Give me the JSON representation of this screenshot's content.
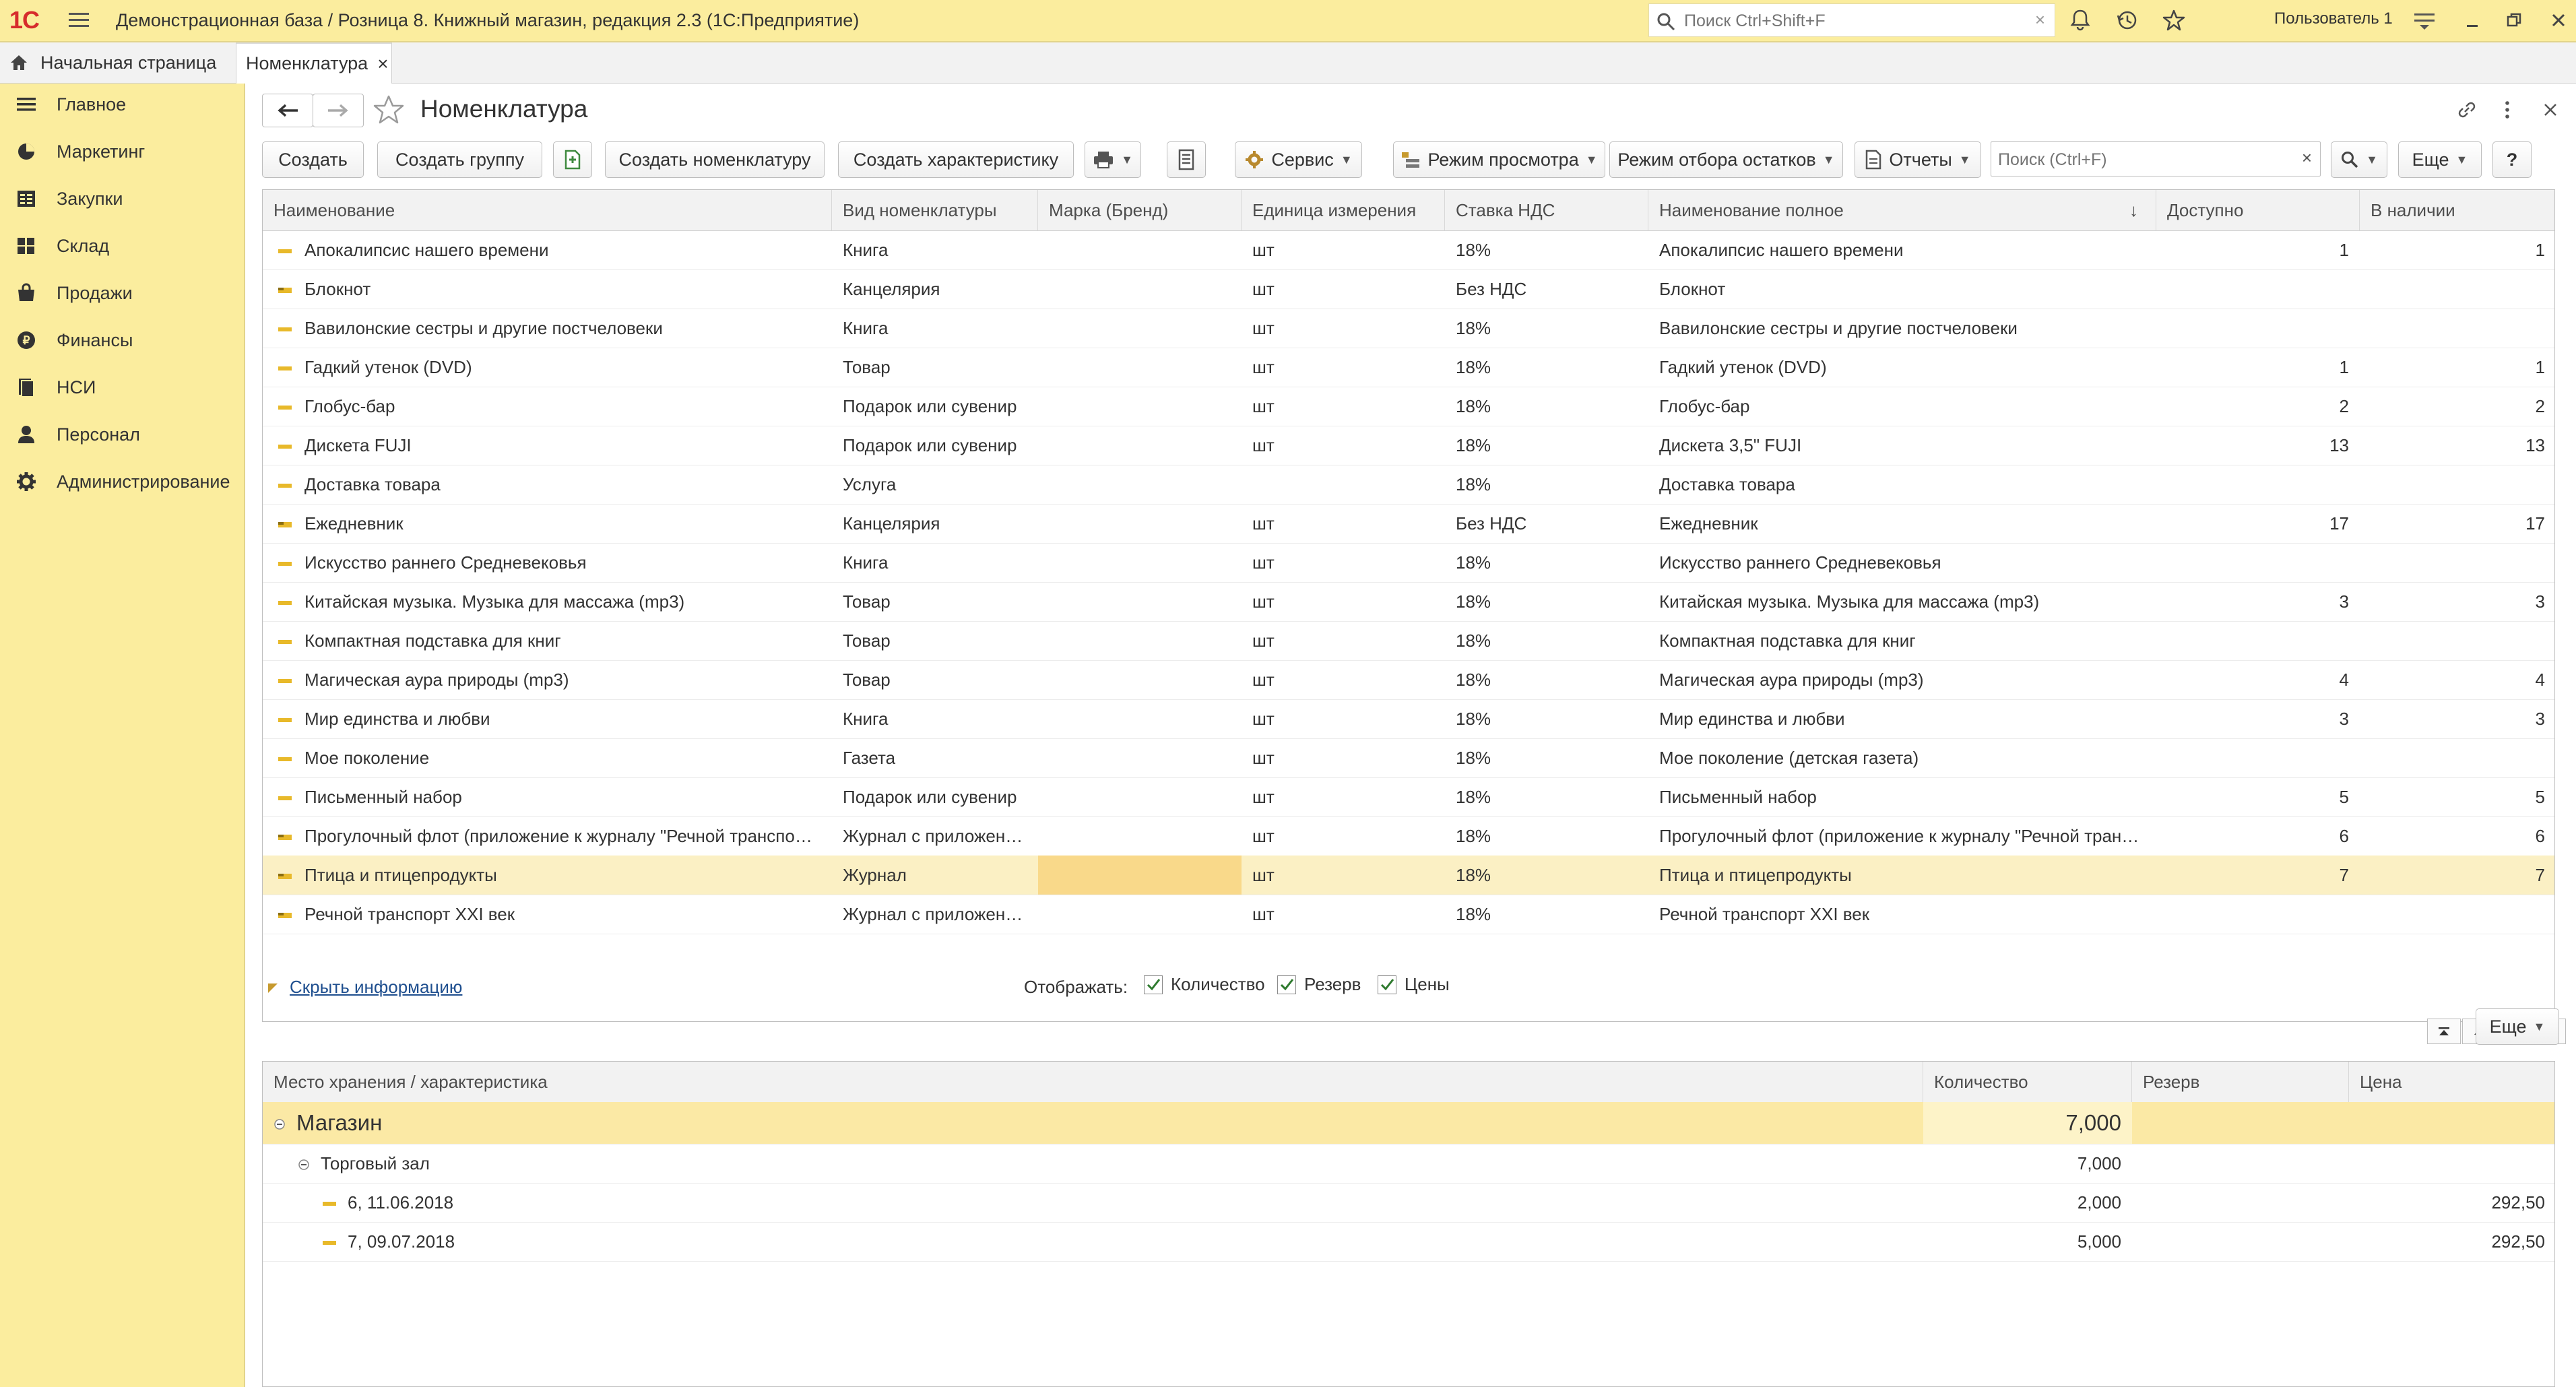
{
  "topbar": {
    "logo": "1С",
    "title": "Демонстрационная база / Розница 8. Книжный магазин, редакция 2.3  (1С:Предприятие)",
    "search_placeholder": "Поиск Ctrl+Shift+F",
    "search_clear": "×",
    "user": "Пользователь 1"
  },
  "tabs": {
    "home": "Начальная страница",
    "active": "Номенклатура",
    "close": "×"
  },
  "sidebar": {
    "items": [
      {
        "label": "Главное",
        "icon": "menu-icon"
      },
      {
        "label": "Маркетинг",
        "icon": "marketing-icon"
      },
      {
        "label": "Закупки",
        "icon": "purchases-icon"
      },
      {
        "label": "Склад",
        "icon": "warehouse-icon"
      },
      {
        "label": "Продажи",
        "icon": "sales-icon"
      },
      {
        "label": "Финансы",
        "icon": "finance-icon"
      },
      {
        "label": "НСИ",
        "icon": "reference-icon"
      },
      {
        "label": "Персонал",
        "icon": "person-icon"
      },
      {
        "label": "Администрирование",
        "icon": "gear-icon"
      }
    ]
  },
  "form": {
    "title": "Номенклатура"
  },
  "toolbar": {
    "create": "Создать",
    "create_group": "Создать группу",
    "create_item": "Создать номенклатуру",
    "create_characteristic": "Создать характеристику",
    "service": "Сервис",
    "view_mode": "Режим просмотра",
    "stock_filter_mode": "Режим отбора остатков",
    "reports": "Отчеты",
    "search_placeholder": "Поиск (Ctrl+F)",
    "search_clear": "×",
    "more": "Еще",
    "help": "?"
  },
  "table": {
    "columns": [
      "Наименование",
      "Вид номенклатуры",
      "Марка (Бренд)",
      "Единица измерения",
      "Ставка НДС",
      "Наименование полное",
      "Доступно",
      "В наличии"
    ],
    "sort_indicator": "↓",
    "rows": [
      {
        "name": "Апокалипсис нашего времени",
        "kind": "Книга",
        "brand": "",
        "unit": "шт",
        "vat": "18%",
        "full": "Апокалипсис нашего времени",
        "avail": "1",
        "stock": "1"
      },
      {
        "name": "Блокнот",
        "kind": "Канцелярия",
        "brand": "",
        "unit": "шт",
        "vat": "Без НДС",
        "full": "Блокнот",
        "avail": "",
        "stock": ""
      },
      {
        "name": "Вавилонские сестры и другие постчеловеки",
        "kind": "Книга",
        "brand": "",
        "unit": "шт",
        "vat": "18%",
        "full": "Вавилонские сестры и другие постчеловеки",
        "avail": "",
        "stock": ""
      },
      {
        "name": "Гадкий утенок (DVD)",
        "kind": "Товар",
        "brand": "",
        "unit": "шт",
        "vat": "18%",
        "full": "Гадкий утенок (DVD)",
        "avail": "1",
        "stock": "1"
      },
      {
        "name": "Глобус-бар",
        "kind": "Подарок или сувенир",
        "brand": "",
        "unit": "шт",
        "vat": "18%",
        "full": "Глобус-бар",
        "avail": "2",
        "stock": "2"
      },
      {
        "name": "Дискета FUJI",
        "kind": "Подарок или сувенир",
        "brand": "",
        "unit": "шт",
        "vat": "18%",
        "full": "Дискета 3,5\" FUJI",
        "avail": "13",
        "stock": "13"
      },
      {
        "name": "Доставка товара",
        "kind": "Услуга",
        "brand": "",
        "unit": "",
        "vat": "18%",
        "full": "Доставка товара",
        "avail": "",
        "stock": ""
      },
      {
        "name": "Ежедневник",
        "kind": "Канцелярия",
        "brand": "",
        "unit": "шт",
        "vat": "Без НДС",
        "full": "Ежедневник",
        "avail": "17",
        "stock": "17"
      },
      {
        "name": "Искусство раннего Средневековья",
        "kind": "Книга",
        "brand": "",
        "unit": "шт",
        "vat": "18%",
        "full": "Искусство раннего Средневековья",
        "avail": "",
        "stock": ""
      },
      {
        "name": "Китайская музыка. Музыка для массажа (mp3)",
        "kind": "Товар",
        "brand": "",
        "unit": "шт",
        "vat": "18%",
        "full": "Китайская музыка. Музыка для массажа (mp3)",
        "avail": "3",
        "stock": "3"
      },
      {
        "name": "Компактная подставка для книг",
        "kind": "Товар",
        "brand": "",
        "unit": "шт",
        "vat": "18%",
        "full": "Компактная подставка для книг",
        "avail": "",
        "stock": ""
      },
      {
        "name": "Магическая аура природы (mp3)",
        "kind": "Товар",
        "brand": "",
        "unit": "шт",
        "vat": "18%",
        "full": "Магическая аура природы (mp3)",
        "avail": "4",
        "stock": "4"
      },
      {
        "name": "Мир единства и любви",
        "kind": "Книга",
        "brand": "",
        "unit": "шт",
        "vat": "18%",
        "full": "Мир единства и любви",
        "avail": "3",
        "stock": "3"
      },
      {
        "name": "Мое поколение",
        "kind": "Газета",
        "brand": "",
        "unit": "шт",
        "vat": "18%",
        "full": "Мое поколение (детская газета)",
        "avail": "",
        "stock": ""
      },
      {
        "name": "Письменный набор",
        "kind": "Подарок или сувенир",
        "brand": "",
        "unit": "шт",
        "vat": "18%",
        "full": "Письменный набор",
        "avail": "5",
        "stock": "5"
      },
      {
        "name": "Прогулочный флот (приложение к журналу \"Речной транспорт XXI век\")",
        "kind": "Журнал с приложением",
        "brand": "",
        "unit": "шт",
        "vat": "18%",
        "full": "Прогулочный флот (приложение к журналу \"Речной транспорт XXI век\")",
        "avail": "6",
        "stock": "6"
      },
      {
        "name": "Птица и птицепродукты",
        "kind": "Журнал",
        "brand": "",
        "unit": "шт",
        "vat": "18%",
        "full": "Птица и птицепродукты",
        "avail": "7",
        "stock": "7"
      },
      {
        "name": "Речной транспорт XXI век",
        "kind": "Журнал с приложением",
        "brand": "",
        "unit": "шт",
        "vat": "18%",
        "full": "Речной транспорт XXI век",
        "avail": "",
        "stock": ""
      }
    ]
  },
  "info": {
    "hide_link": "Скрыть информацию",
    "show_label": "Отображать:",
    "checks": [
      "Количество",
      "Резерв",
      "Цены"
    ],
    "more": "Еще"
  },
  "stock_table": {
    "columns": [
      "Место хранения / характеристика",
      "Количество",
      "Резерв",
      "Цена"
    ],
    "rows": [
      {
        "level": 0,
        "name": "Магазин",
        "qty": "7,000",
        "reserve": "",
        "price": ""
      },
      {
        "level": 1,
        "name": "Торговый зал",
        "qty": "7,000",
        "reserve": "",
        "price": ""
      },
      {
        "level": 2,
        "name": "6, 11.06.2018",
        "qty": "2,000",
        "reserve": "",
        "price": "292,50"
      },
      {
        "level": 2,
        "name": "7, 09.07.2018",
        "qty": "5,000",
        "reserve": "",
        "price": "292,50"
      }
    ]
  },
  "colors": {
    "panel_yellow": "#fbed9e",
    "selected_row": "#fbf0c4",
    "group_row": "#fbe9a5",
    "link": "#1f4f8f"
  }
}
